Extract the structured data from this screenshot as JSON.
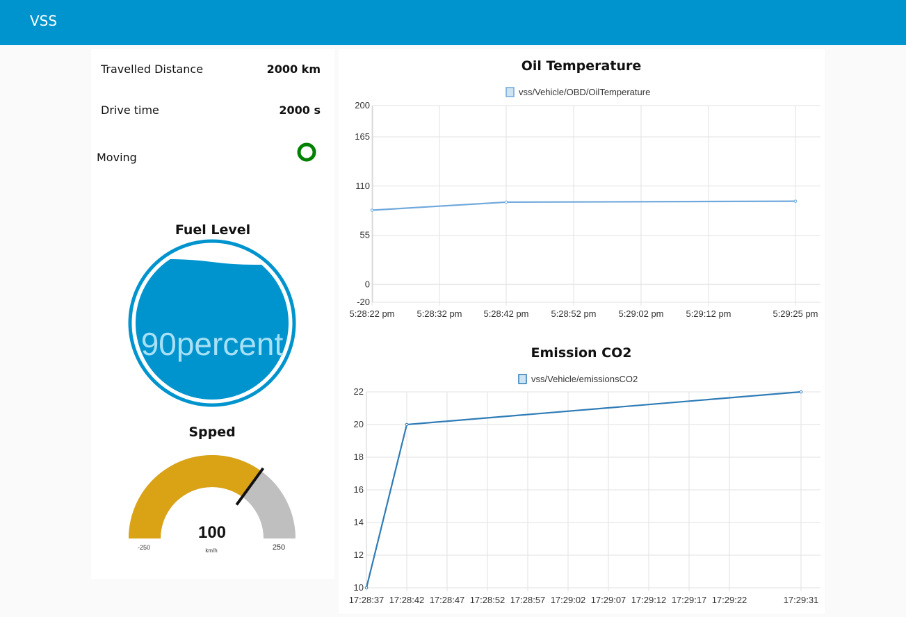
{
  "header": {
    "title": "VSS"
  },
  "left_panel": {
    "travelled_distance": {
      "label": "Travelled Distance",
      "value": "2000 km"
    },
    "drive_time": {
      "label": "Drive time",
      "value": "2000 s"
    },
    "moving": {
      "label": "Moving",
      "indicator_color": "#008000"
    },
    "fuel_level": {
      "title": "Fuel Level",
      "value_text": "90percent",
      "level": 0.9,
      "color": "#0094ce"
    },
    "speed": {
      "title": "Spped",
      "value": 100,
      "value_text": "100",
      "unit": "km/h",
      "min": -250,
      "max": 250,
      "min_text": "-250",
      "max_text": "250",
      "fill_color": "#daa215",
      "track_color": "#bfbfbf"
    }
  },
  "chart_data": [
    {
      "type": "line",
      "title": "Oil Temperature",
      "series": [
        {
          "name": "vss/Vehicle/OBD/OilTemperature",
          "x": [
            "5:28:22 pm",
            "5:28:42 pm",
            "5:29:25 pm"
          ],
          "values": [
            83,
            92,
            93
          ]
        }
      ],
      "x_ticks": [
        "5:28:22 pm",
        "5:28:32 pm",
        "5:28:42 pm",
        "5:28:52 pm",
        "5:29:02 pm",
        "5:29:12 pm",
        "5:29:25 pm"
      ],
      "y_ticks": [
        -20,
        0,
        55,
        110,
        165,
        200
      ],
      "ylim": [
        -20,
        200
      ],
      "grid": true,
      "legend_position": "top",
      "line_color": "#6fa8dc"
    },
    {
      "type": "line",
      "title": "Emission CO2",
      "series": [
        {
          "name": "vss/Vehicle/emissionsCO2",
          "x": [
            "17:28:37",
            "17:28:42",
            "17:29:31"
          ],
          "values": [
            10,
            20,
            22
          ]
        }
      ],
      "x_ticks": [
        "17:28:37",
        "17:28:42",
        "17:28:47",
        "17:28:52",
        "17:28:57",
        "17:29:02",
        "17:29:07",
        "17:29:12",
        "17:29:17",
        "17:29:22",
        "17:29:31"
      ],
      "y_ticks": [
        10,
        12,
        14,
        16,
        18,
        20,
        22
      ],
      "ylim": [
        10,
        22
      ],
      "grid": true,
      "legend_position": "top",
      "line_color": "#2e7bb6"
    }
  ]
}
